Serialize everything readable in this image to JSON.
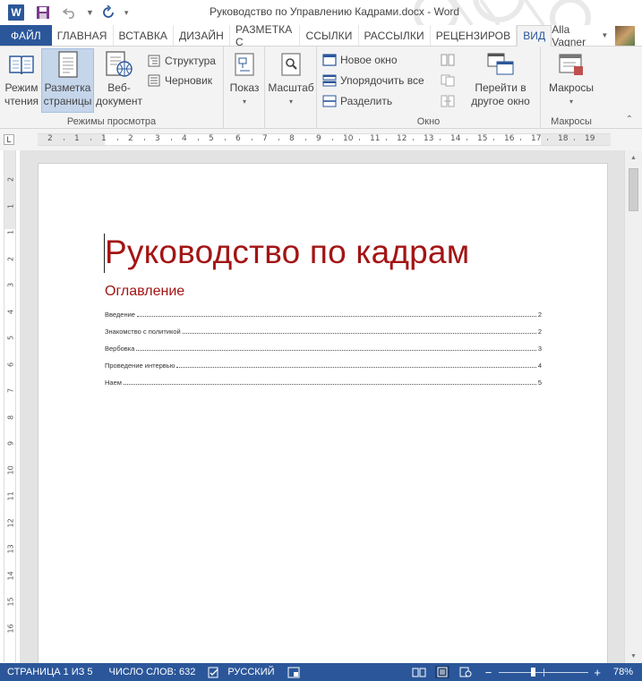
{
  "window": {
    "title": "Руководство по Управлению Кадрами.docx - Word"
  },
  "tabs": {
    "file": "ФАЙЛ",
    "items": [
      "ГЛАВНАЯ",
      "ВСТАВКА",
      "ДИЗАЙН",
      "РАЗМЕТКА С",
      "ССЫЛКИ",
      "РАССЫЛКИ",
      "РЕЦЕНЗИРОВ",
      "ВИД"
    ],
    "active": "ВИД"
  },
  "user": {
    "name": "Alla Vagner"
  },
  "ribbon": {
    "views": {
      "read_mode": [
        "Режим",
        "чтения"
      ],
      "print_layout": [
        "Разметка",
        "страницы"
      ],
      "web_layout": [
        "Веб-",
        "документ"
      ],
      "outline": "Структура",
      "draft": "Черновик",
      "group_label": "Режимы просмотра"
    },
    "show": {
      "label": "Показ"
    },
    "zoom": {
      "label": "Масштаб"
    },
    "window": {
      "new_window": "Новое окно",
      "arrange_all": "Упорядочить все",
      "split": "Разделить",
      "switch_windows": [
        "Перейти в",
        "другое окно"
      ],
      "group_label": "Окно"
    },
    "macros": {
      "label": "Макросы",
      "group_label": "Макросы"
    }
  },
  "ruler": {
    "h_numbers": [
      "2",
      "1",
      "1",
      "2",
      "3",
      "4",
      "5",
      "6",
      "7",
      "8",
      "9",
      "10",
      "11",
      "12",
      "13",
      "14",
      "15",
      "16",
      "17",
      "18",
      "19"
    ],
    "v_numbers": [
      "2",
      "1",
      "1",
      "2",
      "3",
      "4",
      "5",
      "6",
      "7",
      "8",
      "9",
      "10",
      "11",
      "12",
      "13",
      "14",
      "15",
      "16"
    ]
  },
  "document": {
    "title": "Руководство по кадрам",
    "toc_heading": "Оглавление",
    "toc": [
      {
        "text": "Введение",
        "page": "2"
      },
      {
        "text": "Знакомство с политикой",
        "page": "2"
      },
      {
        "text": "Вербовка",
        "page": "3"
      },
      {
        "text": "Проведение интервью",
        "page": "4"
      },
      {
        "text": "Наем",
        "page": "5"
      }
    ]
  },
  "status": {
    "page": "СТРАНИЦА 1 ИЗ 5",
    "words": "ЧИСЛО СЛОВ: 632",
    "language": "РУССКИЙ",
    "zoom": "78%",
    "zoom_fraction": 0.78
  },
  "colors": {
    "accent": "#2b579a",
    "heading": "#a31515",
    "ribbon_bg": "#f3f3f3"
  }
}
